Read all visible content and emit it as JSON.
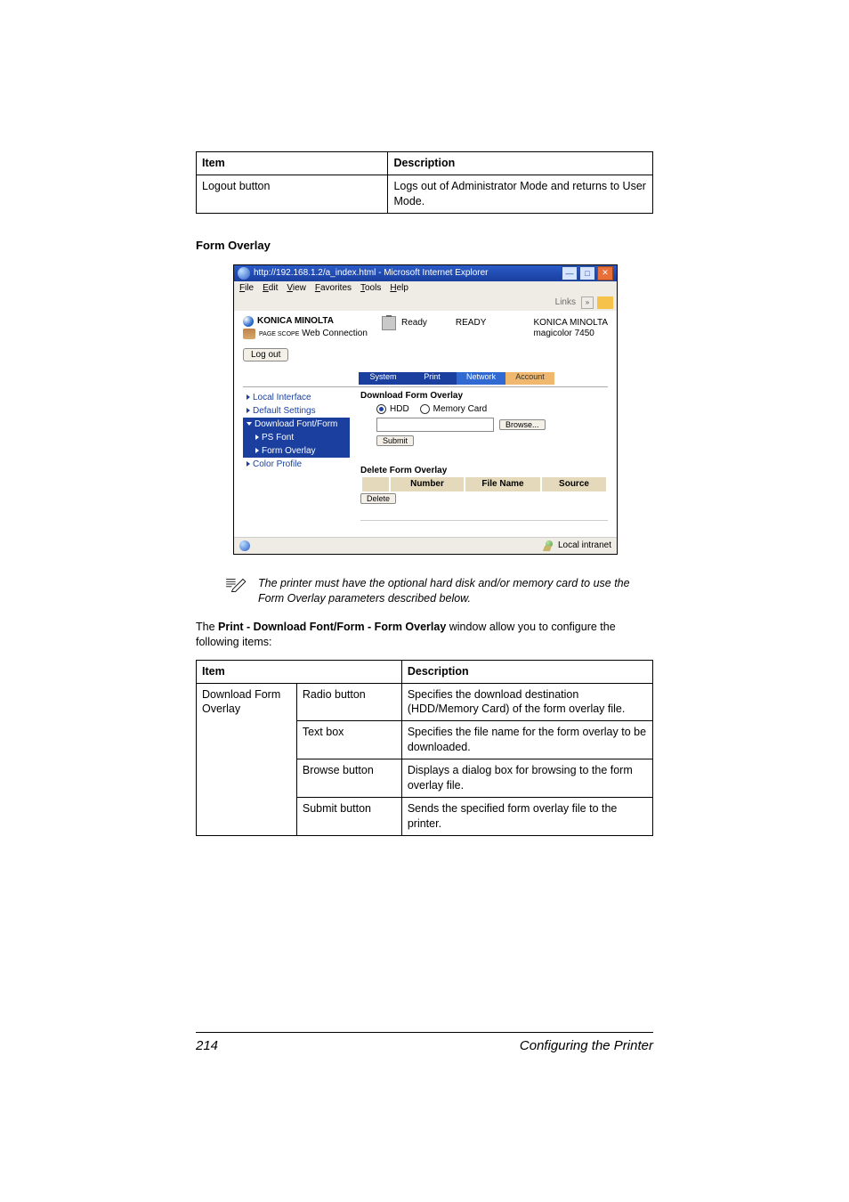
{
  "table1": {
    "h_item": "Item",
    "h_desc": "Description",
    "row_item": "Logout button",
    "row_desc": "Logs out of Administrator Mode and returns to User Mode."
  },
  "section_title": "Form Overlay",
  "screenshot": {
    "title": "http://192.168.1.2/a_index.html - Microsoft Internet Explorer",
    "menus": {
      "file": "File",
      "edit": "Edit",
      "view": "View",
      "favorites": "Favorites",
      "tools": "Tools",
      "help": "Help"
    },
    "links_label": "Links",
    "brand": "KONICA MINOLTA",
    "pagescope_small": "PAGE SCOPE",
    "webconn": "Web Connection",
    "ready_small": "Ready",
    "ready_big": "READY",
    "right_brand": "KONICA MINOLTA",
    "right_model": "magicolor 7450",
    "logout": "Log out",
    "tabs": {
      "system": "System",
      "print": "Print",
      "network": "Network",
      "account": "Account"
    },
    "side": {
      "local": "Local Interface",
      "default": "Default Settings",
      "dl": "Download Font/Form",
      "ps": "PS Font",
      "overlay": "Form Overlay",
      "color": "Color Profile"
    },
    "form": {
      "dl_title": "Download Form Overlay",
      "hdd": "HDD",
      "mem": "Memory Card",
      "browse": "Browse...",
      "submit": "Submit",
      "del_title": "Delete Form Overlay",
      "th_blank": " ",
      "th_number": "Number",
      "th_file": "File Name",
      "th_source": "Source",
      "delete": "Delete"
    },
    "status_zone": "Local intranet"
  },
  "note": "The printer must have the optional hard disk and/or memory card to use the Form Overlay parameters described below.",
  "para_prefix": "The ",
  "para_bold": "Print - Download Font/Form - Form Overlay",
  "para_suffix": " window allow you to configure the following items:",
  "table2": {
    "h_item": "Item",
    "h_desc": "Description",
    "r1c1": "Download Form Overlay",
    "r1c2": "Radio button",
    "r1c3": "Specifies the download destination (HDD/Memory Card) of the form overlay file.",
    "r2c2": "Text box",
    "r2c3": "Specifies the file name for the form overlay to be downloaded.",
    "r3c2": "Browse button",
    "r3c3": "Displays a dialog box for browsing to the form overlay file.",
    "r4c2": "Submit button",
    "r4c3": "Sends the specified form overlay file to the printer."
  },
  "footer": {
    "page": "214",
    "section": "Configuring the Printer"
  }
}
